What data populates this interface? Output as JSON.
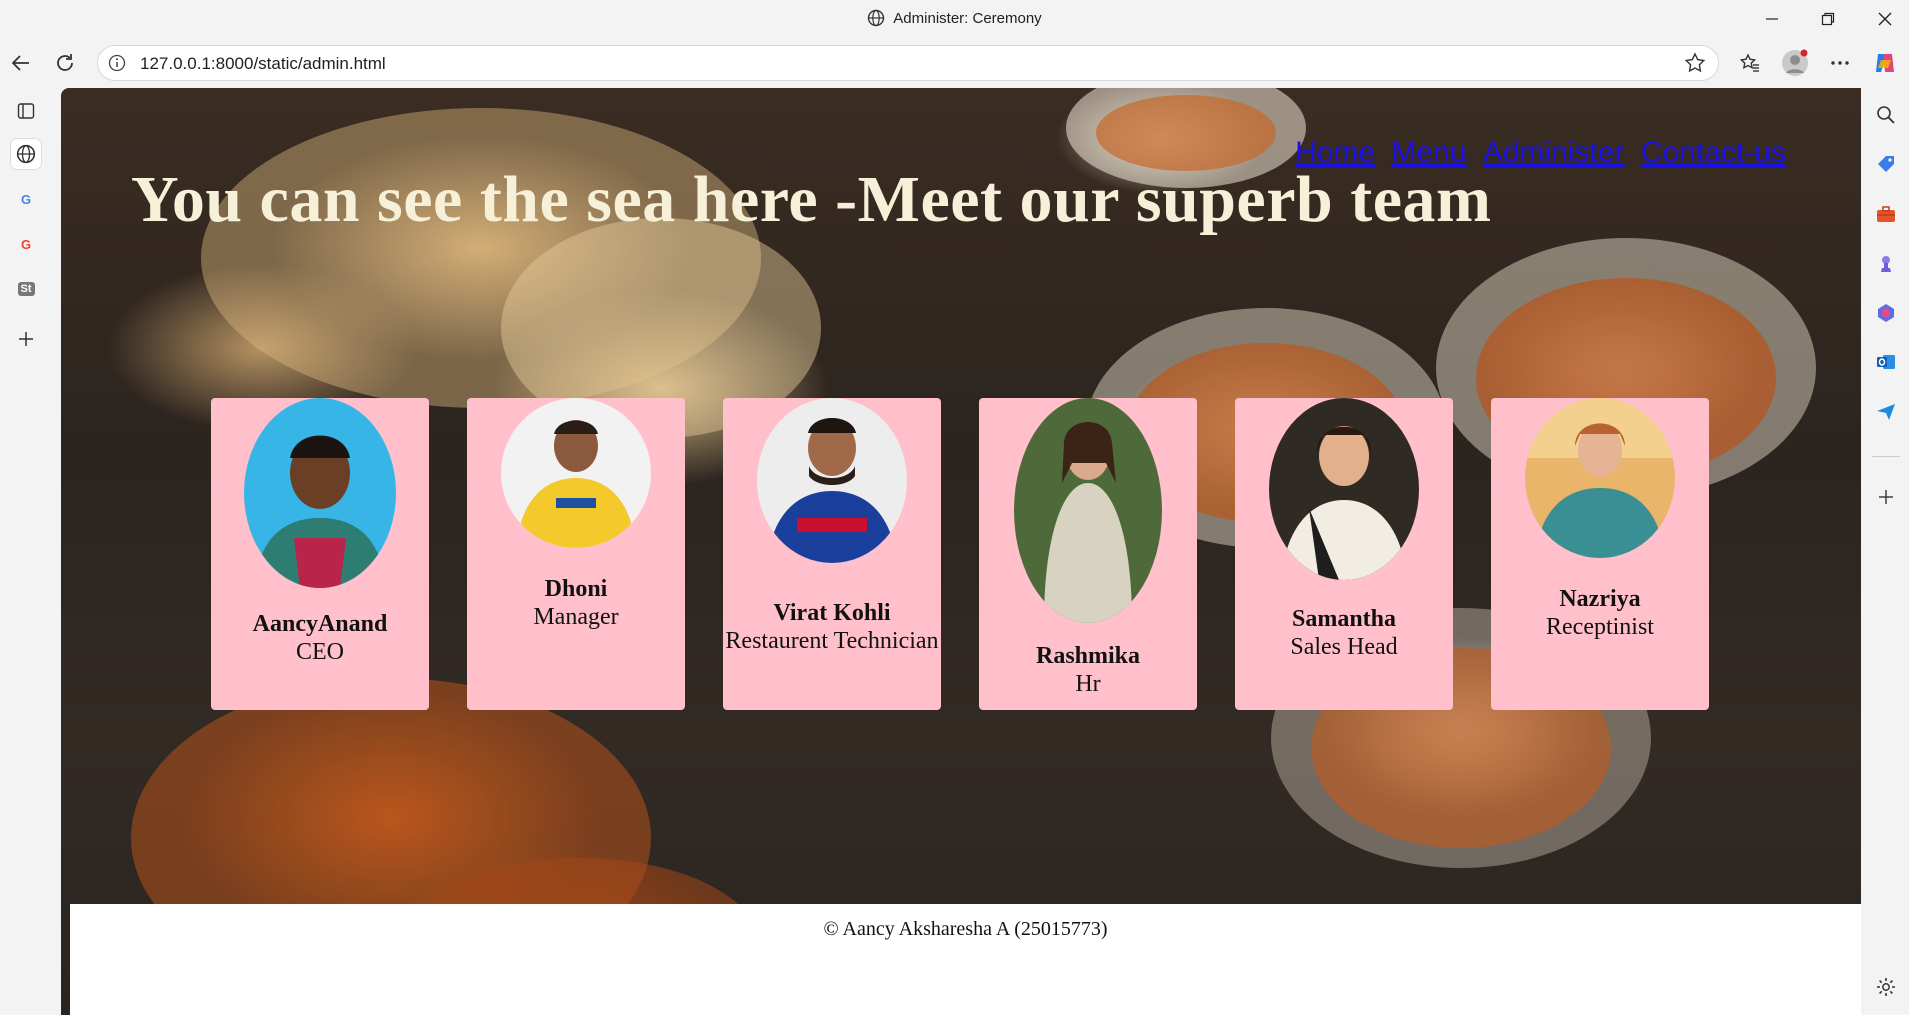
{
  "browser": {
    "window_title": "Administer: Ceremony",
    "url": "127.0.0.1:8000/static/admin.html"
  },
  "page": {
    "nav": [
      "Home",
      "Menu",
      "Administer",
      "Contact-us"
    ],
    "hero_title": "You can see the sea here -Meet our superb team",
    "team": [
      {
        "name": "AancyAnand",
        "role": "CEO"
      },
      {
        "name": "Dhoni",
        "role": "Manager"
      },
      {
        "name": "Virat Kohli",
        "role": "Restaurent Technician"
      },
      {
        "name": "Rashmika",
        "role": "Hr"
      },
      {
        "name": "Samantha",
        "role": "Sales Head"
      },
      {
        "name": "Nazriya",
        "role": "Receptinist"
      }
    ],
    "footer": "© Aancy Aksharesha A (25015773)"
  },
  "colors": {
    "card_bg": "#ffc0cb",
    "link": "#1a10e8",
    "hero_text": "#f6f0d8"
  },
  "icons": {
    "left_rail": [
      "tab-actions-icon",
      "globe-icon",
      "google-icon",
      "google-icon",
      "st-icon",
      "add-icon"
    ],
    "right_rail": [
      "search-icon",
      "tag-icon",
      "toolbox-icon",
      "chess-icon",
      "copilot-icon",
      "outlook-icon",
      "send-icon",
      "add-icon",
      "settings-icon"
    ]
  }
}
